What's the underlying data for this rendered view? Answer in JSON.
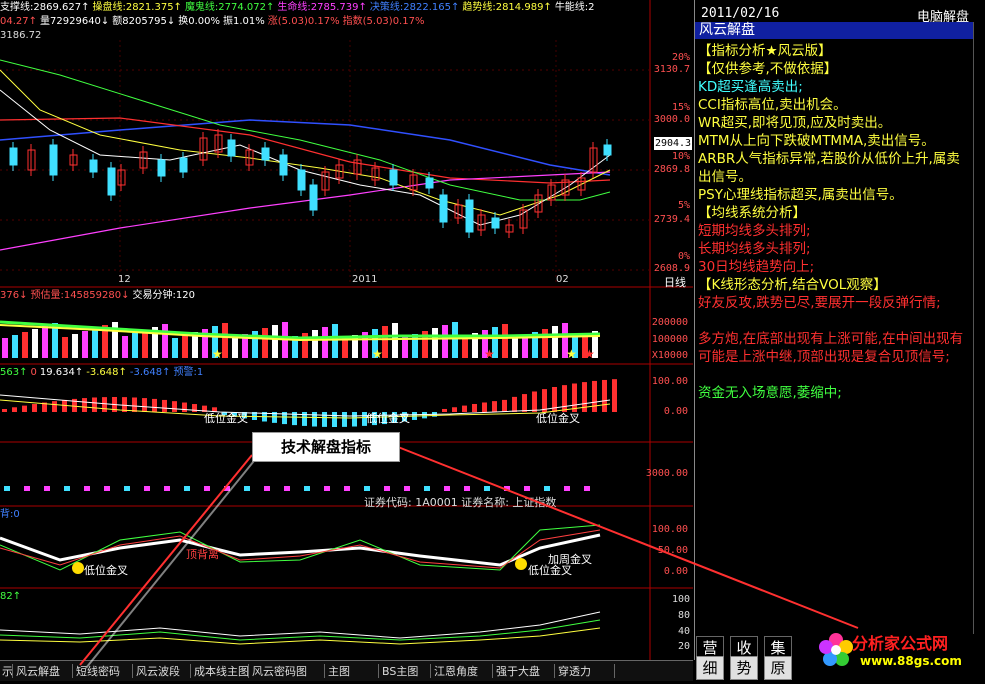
{
  "top_header": {
    "line1": [
      {
        "label": "支撑线:2869.627↑",
        "color": "#ffffff"
      },
      {
        "label": "操盘线:2821.375↑",
        "color": "#ffff40"
      },
      {
        "label": "魔鬼线:2774.072↑",
        "color": "#40ff40"
      },
      {
        "label": "生命线:2785.739↑",
        "color": "#ff40ff"
      },
      {
        "label": "决策线:2822.165↑",
        "color": "#4080ff"
      },
      {
        "label": "趋势线:2814.989↑",
        "color": "#ffff40"
      },
      {
        "label": "牛能线:2",
        "color": "#ffffff"
      }
    ],
    "line2": [
      {
        "label": "04.27↑",
        "color": "#ff5050"
      },
      {
        "label": "量72929640↓",
        "color": "#ffffff"
      },
      {
        "label": "额8205795↓",
        "color": "#ffffff"
      },
      {
        "label": "换0.00%",
        "color": "#ffffff"
      },
      {
        "label": "振1.01%",
        "color": "#ffffff"
      },
      {
        "label": "涨(5.03)0.17%",
        "color": "#ff5050"
      },
      {
        "label": "指数(5.03)0.17%",
        "color": "#ff5050"
      }
    ],
    "line3": "3186.72"
  },
  "price_axis": {
    "labels": [
      "3130.7",
      "3000.0",
      "2869.8",
      "2739.4",
      "2608.9"
    ],
    "pct": [
      "20%",
      "15%",
      "10%",
      "5%",
      "0%"
    ],
    "current": "2904.3",
    "x_dates": [
      "12",
      "2011",
      "02"
    ],
    "x_axis_label": "日线"
  },
  "volume_panel": {
    "header": [
      {
        "label": "376↓",
        "color": "#ff5050"
      },
      {
        "label": "预估量:145859280↓",
        "color": "#ff5050"
      },
      {
        "label": "交易分钟:120",
        "color": "#ffffff"
      }
    ],
    "axis": [
      "200000",
      "100000",
      "X10000"
    ]
  },
  "macd_panel": {
    "header": [
      {
        "label": "563↑",
        "color": "#40ff40"
      },
      {
        "label": "0",
        "color": "#ff5050"
      },
      {
        "label": "19.634↑",
        "color": "#ffffff"
      },
      {
        "label": "-3.648↑",
        "color": "#ffff40"
      },
      {
        "label": "-3.648↑",
        "color": "#4080ff"
      },
      {
        "label": "预警:1",
        "color": "#4080ff"
      }
    ],
    "axis": [
      "100.00",
      "0.00"
    ],
    "labels": [
      "低位金叉",
      "低位金叉",
      "低位金叉"
    ]
  },
  "blank_panel": {
    "axis": [
      "3000.00"
    ],
    "info": "证券代码: 1A0001  证券名称: 上证指数"
  },
  "kdj_panel": {
    "header": "背:0",
    "axis": [
      "100.00",
      "50.00",
      "0.00"
    ],
    "labels": [
      "低位金叉",
      "顶背离",
      "低位金叉",
      "加周金叉"
    ]
  },
  "bottom_panel": {
    "header": "82↑",
    "axis": [
      "100",
      "80",
      "60",
      "40",
      "20"
    ]
  },
  "callout": "技术解盘指标",
  "tabs": [
    "示",
    "风云解盘",
    "短线密码",
    "风云波段",
    "成本线主图",
    "风云密码图",
    "主图",
    "BS主图",
    "江恩角度",
    "强于大盘",
    "穿透力"
  ],
  "right_panel": {
    "date": "2011/02/16",
    "top_title": "电脑解盘",
    "title": "风云解盘",
    "lines": [
      {
        "text": "【指标分析★风云版】",
        "cls": "yellow"
      },
      {
        "text": "【仅供参考,不做依据】",
        "cls": "yellow"
      },
      {
        "text": "KD超买逢高卖出;",
        "cls": "cyan"
      },
      {
        "text": "CCI指标高位,卖出机会。",
        "cls": "yellow"
      },
      {
        "text": "WR超买,即将见顶,应及时卖出。",
        "cls": "yellow"
      },
      {
        "text": "MTM从上向下跌破MTMMA,卖出信号。",
        "cls": "yellow"
      },
      {
        "text": "ARBR人气指标异常,若股价从低价上升,属卖出信号。",
        "cls": "yellow"
      },
      {
        "text": "PSY心理线指标超买,属卖出信号。",
        "cls": "yellow"
      },
      {
        "text": "【均线系统分析】",
        "cls": "yellow"
      },
      {
        "text": "短期均线多头排列;",
        "cls": "red"
      },
      {
        "text": "长期均线多头排列;",
        "cls": "red"
      },
      {
        "text": "30日均线趋势向上;",
        "cls": "red"
      },
      {
        "text": "【K线形态分析,结合VOL观察】",
        "cls": "yellow"
      },
      {
        "text": "好友反攻,跌势已尽,要展开一段反弹行情;",
        "cls": "red"
      },
      {
        "text": "多方炮,在底部出现有上涨可能,在中间出现有可能是上涨中继,顶部出现是复合见顶信号;",
        "cls": "red"
      },
      {
        "text": "资金无入场意愿,萎缩中;",
        "cls": "green"
      }
    ]
  },
  "side_tabs": [
    "营",
    "收",
    "集",
    "细",
    "势",
    "原"
  ],
  "watermark": {
    "name": "分析家公式网",
    "url": "www.88gs.com"
  }
}
